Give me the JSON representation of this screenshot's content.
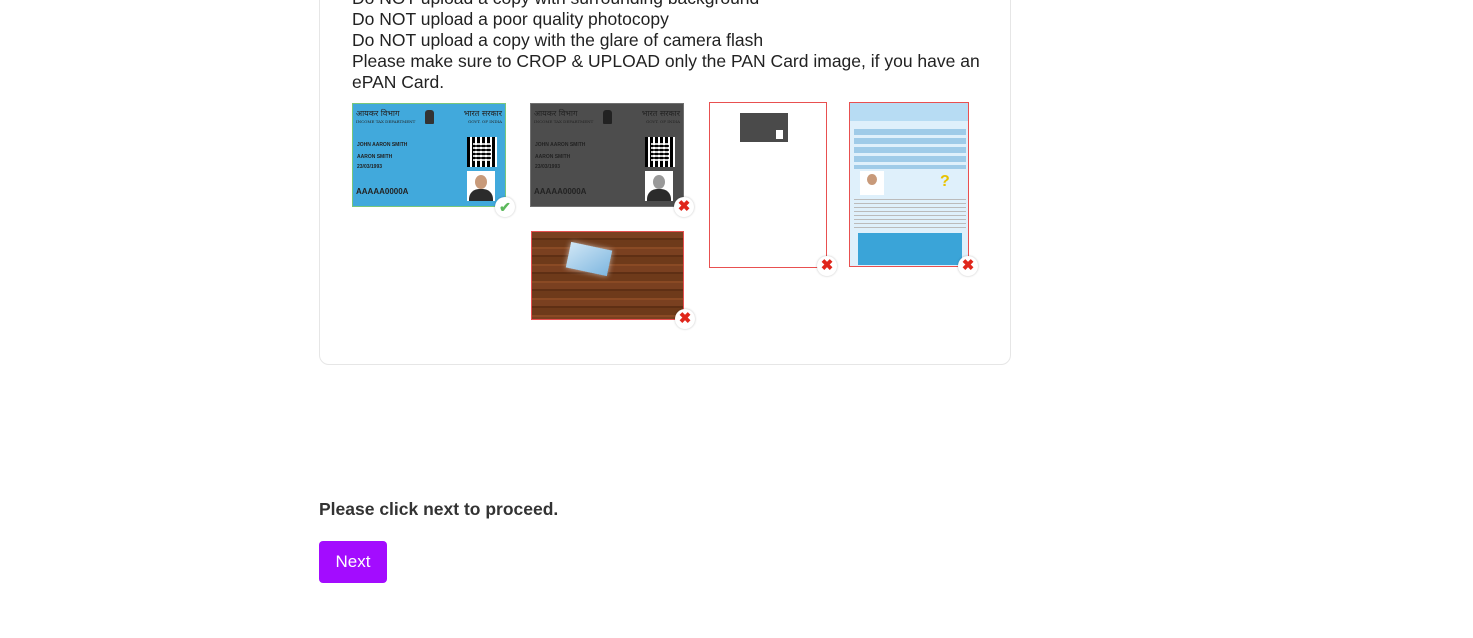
{
  "guidelines": [
    "Do NOT upload a copy with surrounding background",
    "Do NOT upload a poor quality photocopy",
    "Do NOT upload a copy with the glare of camera flash",
    "Please make sure to CROP & UPLOAD only the PAN Card image, if you have an ePAN Card."
  ],
  "pan_card": {
    "dept_hindi": "आयकर विभाग",
    "dept_english": "INCOME TAX DEPARTMENT",
    "govt_hindi": "भारत सरकार",
    "govt_english": "GOVT. OF INDIA",
    "name": "JOHN AARON SMITH",
    "father_name": "AARON SMITH",
    "dob": "23/03/1993",
    "pan_number": "AAAAA0000A"
  },
  "samples": [
    {
      "label": "correct-color-pan",
      "status": "ok",
      "mark": "✔"
    },
    {
      "label": "grayscale-photocopy",
      "status": "bad",
      "mark": "✖"
    },
    {
      "label": "card-on-background",
      "status": "bad",
      "mark": "✖"
    },
    {
      "label": "uncropped-page",
      "status": "bad",
      "mark": "✖"
    },
    {
      "label": "full-epan-page",
      "status": "bad",
      "mark": "✖"
    }
  ],
  "colors": {
    "card_blue": "#41a9dc",
    "grayscale": "#4d4d4d",
    "wood": "#6e3a1a",
    "error_border": "#e85050",
    "next_button": "#a30cff"
  },
  "proceed_text": "Please click next to proceed.",
  "next_label": "Next"
}
